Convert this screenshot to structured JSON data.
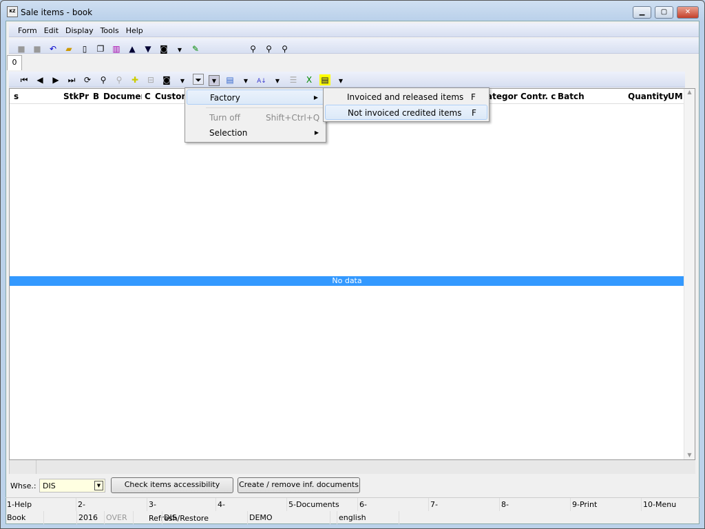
{
  "window": {
    "title": "Sale items - book",
    "icon": "KZ"
  },
  "menu": [
    "Form",
    "Edit",
    "Display",
    "Tools",
    "Help"
  ],
  "tab": "0",
  "grid": {
    "columns": [
      "s",
      "StkPr",
      "B",
      "Documer",
      "C",
      "Custom",
      "ategor",
      "Contr. c",
      "Batch",
      "Quantity",
      "UM"
    ],
    "empty_text": "No data"
  },
  "filter_menu": {
    "items": [
      {
        "label": "Factory"
      },
      {
        "label": "Turn off",
        "shortcut": "Shift+Ctrl+Q",
        "disabled": true
      },
      {
        "label": "Selection"
      }
    ]
  },
  "submenu": {
    "items": [
      {
        "label": "Invoiced and released items",
        "shortcut": "F"
      },
      {
        "label": "Not invoiced credited items",
        "shortcut": "F"
      }
    ]
  },
  "bottom": {
    "whse_label": "Whse.:",
    "whse_value": "DIS",
    "check_btn": "Check items accessibility",
    "create_btn": "Create / remove inf. documents"
  },
  "fkeys": [
    "1-Help",
    "2-",
    "3-Refresh/Restore",
    "4-",
    "5-Documents",
    "6-",
    "7-",
    "8-",
    "9-Print",
    "10-Menu"
  ],
  "status": [
    "Book",
    "2016",
    "OVER",
    "DIS",
    "DEMO",
    "english"
  ],
  "colors": {
    "selection": "#3399ff",
    "input_bg": "#ffffe1"
  }
}
